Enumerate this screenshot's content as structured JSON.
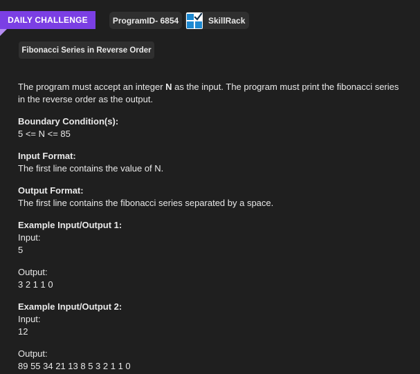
{
  "header": {
    "daily_challenge": "DAILY CHALLENGE",
    "program_id": "ProgramID- 6854",
    "brand": "SkillRack",
    "brand_icon": "skillrack-logo-icon",
    "title": "Fibonacci Series in Reverse Order"
  },
  "problem": {
    "intro_before": "The program must accept an integer ",
    "intro_bold": "N",
    "intro_after": " as the input. The program must print the fibonacci series in the reverse order as the output.",
    "boundary_label": "Boundary Condition(s):",
    "boundary_value": "5 <= N <= 85",
    "input_format_label": "Input Format:",
    "input_format_value": "The first line contains the value of N.",
    "output_format_label": "Output Format:",
    "output_format_value": "The first line contains the fibonacci series separated by a space.",
    "examples": [
      {
        "label": "Example Input/Output 1:",
        "input_label": "Input:",
        "input_value": "5",
        "output_label": "Output:",
        "output_value": "3 2 1 1 0"
      },
      {
        "label": "Example Input/Output 2:",
        "input_label": "Input:",
        "input_value": "12",
        "output_label": "Output:",
        "output_value": "89 55 34 21 13 8 5 3 2 1 1 0"
      }
    ]
  },
  "colors": {
    "background": "#1f1f1f",
    "accent": "#7b3fe4",
    "chip_background": "#2f2f2f",
    "text": "#e9e9e9"
  }
}
